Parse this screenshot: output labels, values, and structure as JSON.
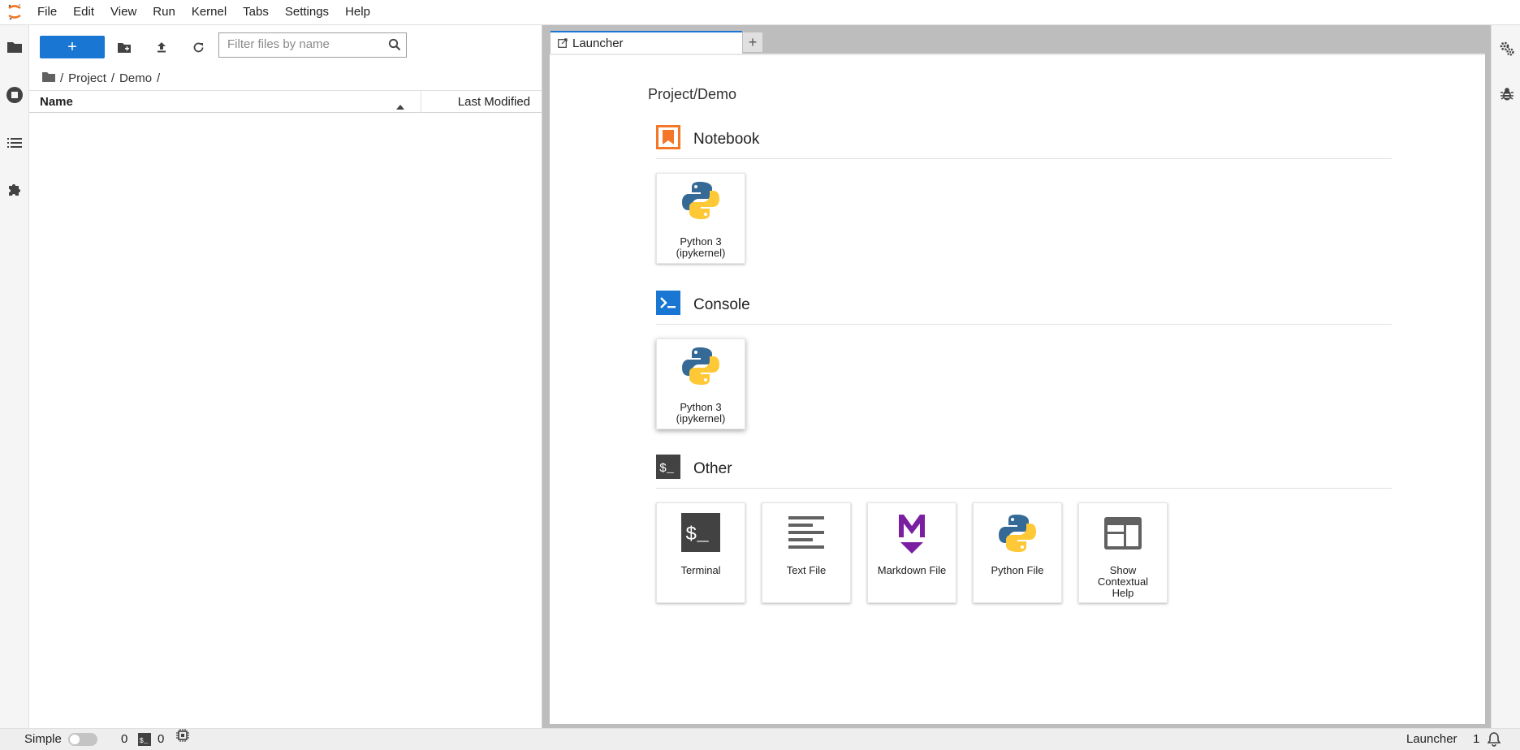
{
  "menubar": {
    "items": [
      "File",
      "Edit",
      "View",
      "Run",
      "Kernel",
      "Tabs",
      "Settings",
      "Help"
    ]
  },
  "filebrowser": {
    "new_label": "+",
    "filter_placeholder": "Filter files by name",
    "breadcrumb": [
      "/",
      "Project",
      "/",
      "Demo",
      "/"
    ],
    "columns": {
      "name": "Name",
      "modified": "Last Modified"
    }
  },
  "tabs": {
    "active_label": "Launcher",
    "add_label": "+"
  },
  "launcher": {
    "cwd": "Project/Demo",
    "sections": {
      "notebook": "Notebook",
      "console": "Console",
      "other": "Other"
    },
    "notebook_cards": [
      {
        "label_line1": "Python 3",
        "label_line2": "(ipykernel)"
      }
    ],
    "console_cards": [
      {
        "label_line1": "Python 3",
        "label_line2": "(ipykernel)"
      }
    ],
    "other_cards": {
      "terminal": "Terminal",
      "text_file": "Text File",
      "markdown_file": "Markdown File",
      "python_file": "Python File",
      "contextual_help_line1": "Show",
      "contextual_help_line2": "Contextual",
      "contextual_help_line3": "Help"
    }
  },
  "statusbar": {
    "mode_label": "Simple",
    "kernels_count": "0",
    "terminals_count": "0",
    "active_document": "Launcher",
    "notifications_count": "1"
  },
  "colors": {
    "accent": "#1976d2",
    "notebook_icon": "#f37726",
    "console_icon": "#1976d2",
    "markdown_icon": "#7b1fa2",
    "python_blue": "#366a96",
    "python_yellow": "#ffc836"
  }
}
